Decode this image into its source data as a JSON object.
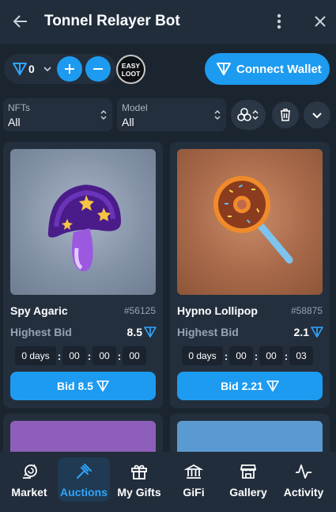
{
  "header": {
    "title": "Tonnel Relayer Bot"
  },
  "wallet": {
    "balance": "0",
    "easy_logo_line1": "EASY",
    "easy_logo_line2": "LOOT",
    "connect_label": "Connect Wallet"
  },
  "filters": [
    {
      "label": "NFTs",
      "value": "All"
    },
    {
      "label": "Model",
      "value": "All"
    }
  ],
  "colors": {
    "accent": "#1d9bf0",
    "bg": "#1b2530",
    "card": "#242f3d"
  },
  "cards": [
    {
      "name": "Spy Agaric",
      "number": "#56125",
      "bid_label": "Highest Bid",
      "bid_value": "8.5",
      "timer": {
        "days": "0 days",
        "h": "00",
        "m": "00",
        "s": "00"
      },
      "button": "Bid 8.5"
    },
    {
      "name": "Hypno Lollipop",
      "number": "#58875",
      "bid_label": "Highest Bid",
      "bid_value": "2.1",
      "timer": {
        "days": "0 days",
        "h": "00",
        "m": "00",
        "s": "03"
      },
      "button": "Bid 2.21"
    }
  ],
  "nav": [
    {
      "label": "Market",
      "icon": "market-icon"
    },
    {
      "label": "Auctions",
      "icon": "gavel-icon",
      "active": true
    },
    {
      "label": "My Gifts",
      "icon": "gift-icon"
    },
    {
      "label": "GiFi",
      "icon": "bank-icon"
    },
    {
      "label": "Gallery",
      "icon": "store-icon"
    },
    {
      "label": "Activity",
      "icon": "activity-icon"
    }
  ]
}
